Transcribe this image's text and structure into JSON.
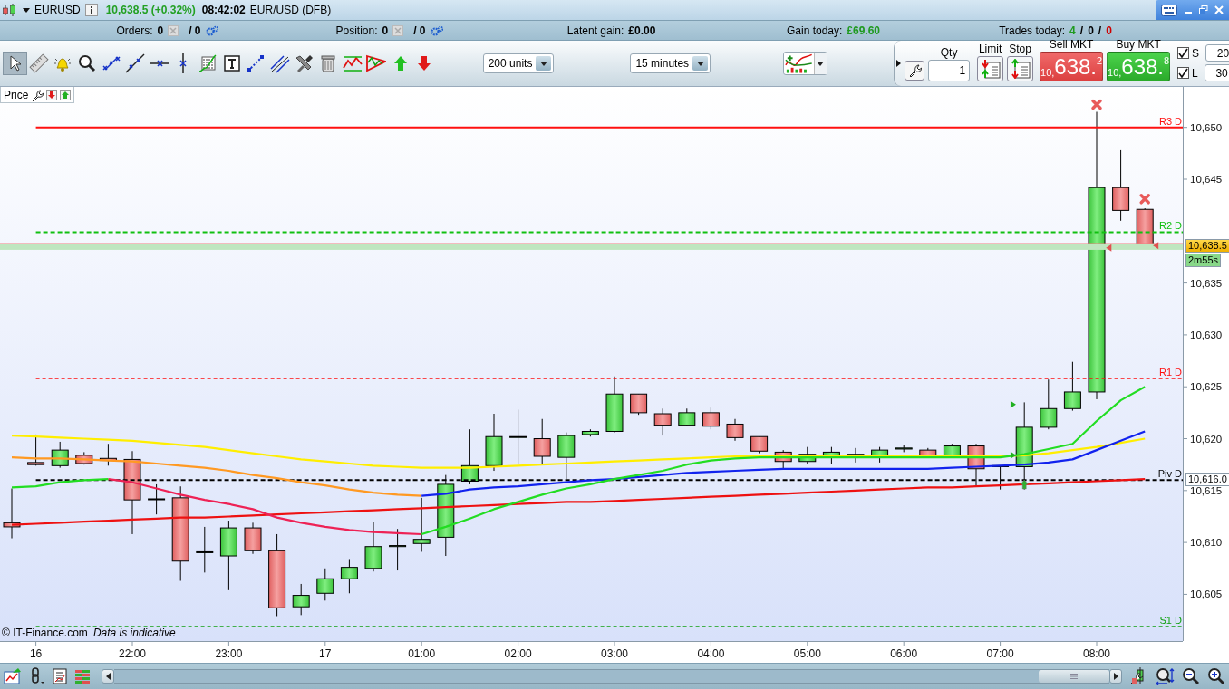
{
  "title_bar": {
    "symbol": "EURUSD",
    "price": "10,638.5 (+0.32%)",
    "time": "08:42:02",
    "market": "EUR/USD (DFB)"
  },
  "info_bar": [
    {
      "kind": "orders",
      "label": "Orders:",
      "value": "0",
      "total": "/ 0"
    },
    {
      "kind": "orders",
      "label": "Position:",
      "value": "0",
      "total": "/ 0"
    },
    {
      "kind": "amount",
      "label": "Latent gain:",
      "value": "£0.00",
      "color": "#000000"
    },
    {
      "kind": "amount",
      "label": "Gain today:",
      "value": "£69.60",
      "color": "#1f9a1f"
    },
    {
      "kind": "counts",
      "label": "Trades today:",
      "separator": "/",
      "counts": [
        {
          "text": "4",
          "color": "#1f9a1f"
        },
        {
          "text": "0",
          "color": "#000000"
        },
        {
          "text": "0",
          "color": "#cc0000"
        }
      ]
    }
  ],
  "toolbar": {
    "tools": [
      {
        "kind": "pointer",
        "selected": true
      },
      {
        "kind": "ruler",
        "selected": false
      },
      {
        "kind": "bell",
        "selected": false
      },
      {
        "kind": "search",
        "selected": false
      },
      {
        "kind": "segment",
        "selected": false
      },
      {
        "kind": "line",
        "selected": false
      },
      {
        "kind": "hline",
        "selected": false
      },
      {
        "kind": "vline",
        "selected": false
      },
      {
        "kind": "levels",
        "selected": false
      },
      {
        "kind": "text",
        "selected": false
      },
      {
        "kind": "dotted",
        "selected": false
      },
      {
        "kind": "channel",
        "selected": false
      },
      {
        "kind": "tools",
        "selected": false
      },
      {
        "kind": "trash",
        "selected": false
      },
      {
        "kind": "zigzag",
        "selected": false
      },
      {
        "kind": "triangle",
        "selected": false
      },
      {
        "kind": "up",
        "selected": false
      },
      {
        "kind": "down",
        "selected": false
      }
    ],
    "units_select": "200 units",
    "interval_select": "15 minutes"
  },
  "trade_panel": {
    "qty_label": "Qty",
    "qty": "1",
    "limit_label": "Limit",
    "stop_label": "Stop",
    "sell": {
      "label": "Sell MKT",
      "prefix": "10,",
      "main": "638.",
      "pip": "2"
    },
    "buy": {
      "label": "Buy MKT",
      "prefix": "10,",
      "main": "638.",
      "pip": "8"
    },
    "stops": [
      {
        "label": "S",
        "checked": true,
        "value": "20"
      },
      {
        "label": "L",
        "checked": true,
        "value": "30"
      }
    ]
  },
  "chart": {
    "price_tab": "Price",
    "source": "© IT-Finance.com",
    "note": "Data is indicative",
    "price_tag": "10,638.5",
    "timer": "2m55s",
    "pivot_tag": "10,616.0",
    "chart_data": {
      "type": "line",
      "ylim": [
        10600.5,
        10653.9
      ],
      "categories": [
        null,
        "16",
        null,
        null,
        null,
        "22:00",
        null,
        null,
        null,
        "23:00",
        null,
        null,
        null,
        "17",
        null,
        null,
        null,
        "01:00",
        null,
        null,
        null,
        "02:00",
        null,
        null,
        null,
        "03:00",
        null,
        null,
        null,
        "04:00",
        null,
        null,
        null,
        "05:00",
        null,
        null,
        null,
        "06:00",
        null,
        null,
        null,
        "07:00",
        null,
        null,
        null,
        "08:00",
        null,
        null
      ],
      "yticks": [
        {
          "value": 10605,
          "label": "10,605"
        },
        {
          "value": 10610,
          "label": "10,610"
        },
        {
          "value": 10615,
          "label": "10,615"
        },
        {
          "value": 10620,
          "label": "10,620"
        },
        {
          "value": 10625,
          "label": "10,625"
        },
        {
          "value": 10630,
          "label": "10,630"
        },
        {
          "value": 10635,
          "label": "10,635"
        },
        {
          "value": 10645,
          "label": "10,645"
        },
        {
          "value": 10650,
          "label": "10,650"
        }
      ],
      "series": [
        {
          "color": "#ee1111",
          "values": [
            10611.7,
            10611.8,
            10611.9,
            10612.0,
            10612.1,
            10612.2,
            10612.3,
            10612.4,
            10612.4,
            10612.5,
            10612.6,
            10612.7,
            10612.8,
            10612.9,
            10613.0,
            10613.1,
            10613.2,
            10613.3,
            10613.4,
            10613.5,
            10613.6,
            10613.7,
            10613.8,
            10613.9,
            10613.9,
            10614.0,
            10614.1,
            10614.2,
            10614.3,
            10614.4,
            10614.5,
            10614.6,
            10614.7,
            10614.8,
            10614.9,
            10615.0,
            10615.1,
            10615.2,
            10615.3,
            10615.3,
            10615.4,
            10615.5,
            10615.6,
            10615.7,
            10615.8,
            10615.9,
            10616.0,
            10616.1
          ]
        },
        {
          "color": "#ff9922",
          "values": [
            10618.2,
            10618.1,
            10618.1,
            10618.0,
            10617.9,
            10617.8,
            10617.6,
            10617.4,
            10617.2,
            10616.9,
            10616.5,
            10616.2,
            10615.8,
            10615.5,
            10615.1,
            10614.8,
            10614.6,
            10614.5,
            null,
            null,
            null,
            null,
            null,
            null,
            null,
            null,
            null,
            null,
            null,
            null,
            null,
            null,
            null,
            null,
            null,
            null,
            null,
            null,
            null,
            null,
            null,
            null,
            null,
            null,
            null,
            null,
            null,
            null
          ]
        },
        {
          "color": "#ffee00",
          "values": [
            10620.3,
            10620.2,
            10620.1,
            10620.0,
            10619.9,
            10619.8,
            10619.6,
            10619.4,
            10619.2,
            10618.9,
            10618.6,
            10618.3,
            10618.0,
            10617.8,
            10617.6,
            10617.4,
            10617.3,
            10617.2,
            10617.2,
            10617.2,
            10617.3,
            10617.4,
            10617.5,
            10617.6,
            10617.7,
            10617.8,
            10617.9,
            10618.0,
            10618.1,
            10618.2,
            10618.3,
            10618.3,
            10618.3,
            10618.3,
            10618.3,
            10618.3,
            10618.3,
            10618.3,
            10618.3,
            10618.3,
            10618.3,
            10618.3,
            10618.4,
            10618.6,
            10618.9,
            10619.2,
            10619.6,
            10620.0
          ]
        },
        {
          "color": "#1122ee",
          "values": [
            null,
            null,
            null,
            null,
            null,
            null,
            null,
            null,
            null,
            null,
            null,
            null,
            null,
            null,
            null,
            null,
            null,
            10614.5,
            10614.7,
            10615.1,
            10615.3,
            10615.4,
            10615.6,
            10615.8,
            10616.0,
            10616.1,
            10616.3,
            10616.5,
            10616.7,
            10616.8,
            10616.9,
            10617.0,
            10617.1,
            10617.1,
            10617.1,
            10617.1,
            10617.1,
            10617.1,
            10617.1,
            10617.2,
            10617.3,
            10617.4,
            10617.5,
            10617.7,
            10618.0,
            10618.9,
            10619.8,
            10620.7
          ]
        },
        {
          "color": "#ee2255",
          "values": [
            null,
            null,
            null,
            null,
            10616.1,
            10615.8,
            10615.2,
            10614.6,
            10614.1,
            10613.7,
            10613.2,
            10612.4,
            10611.9,
            10611.5,
            10611.2,
            10611.0,
            10610.9,
            10610.8,
            null,
            null,
            null,
            null,
            null,
            null,
            null,
            null,
            null,
            null,
            null,
            null,
            null,
            null,
            null,
            null,
            null,
            null,
            null,
            null,
            null,
            null,
            null,
            null,
            null,
            null,
            null,
            null,
            null,
            null
          ]
        },
        {
          "color": "#22dd22",
          "values": [
            10615.3,
            10615.4,
            10615.8,
            10616.0,
            10616.1,
            null,
            null,
            null,
            null,
            null,
            null,
            null,
            null,
            null,
            null,
            null,
            null,
            10610.8,
            10611.5,
            10612.3,
            10613.2,
            10613.9,
            10614.6,
            10615.2,
            10615.6,
            10616.1,
            10616.5,
            10616.9,
            10617.5,
            10617.9,
            10618.1,
            10618.2,
            10618.2,
            10618.2,
            10618.2,
            10618.2,
            10618.2,
            10618.2,
            10618.2,
            10618.2,
            10618.2,
            10618.2,
            10618.5,
            10619.0,
            10619.5,
            10621.7,
            10623.7,
            10625.0
          ]
        }
      ],
      "ref_lines": [
        {
          "axis": "y",
          "value": 10650,
          "label": "R3 D",
          "color": "#ff1010"
        },
        {
          "axis": "y",
          "value": 10639.9,
          "label": "R2 D",
          "color": "#10c010"
        },
        {
          "axis": "y",
          "value": 10625.8,
          "label": "R1 D",
          "color": "#ff1010"
        },
        {
          "axis": "y",
          "value": 10616,
          "label": "Piv D",
          "color": "#000000"
        },
        {
          "axis": "y",
          "value": 10601.9,
          "label": "S1 D",
          "color": "#10a010"
        },
        {
          "axis": "y",
          "value": 10638.8,
          "color": "#f08080"
        }
      ],
      "bands": [
        {
          "axis": "y",
          "from": 10638.2,
          "to": 10638.8,
          "color": "#bfe6bf"
        }
      ]
    }
  }
}
